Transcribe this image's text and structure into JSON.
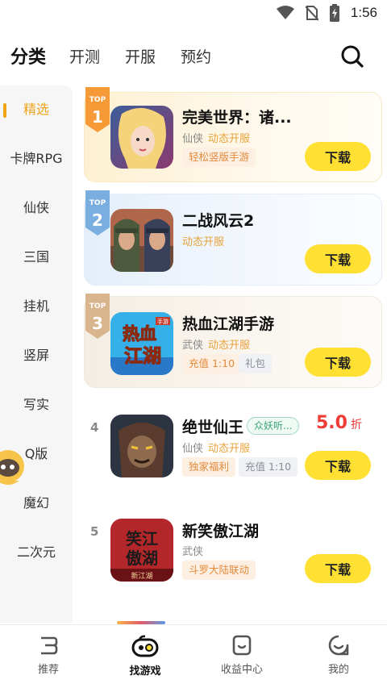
{
  "status_bar": {
    "time": "1:56",
    "icons": [
      "wifi-icon",
      "no-sim-icon",
      "battery-charging-icon"
    ]
  },
  "header": {
    "tabs": [
      {
        "label": "分类",
        "active": true
      },
      {
        "label": "开测",
        "active": false
      },
      {
        "label": "开服",
        "active": false
      },
      {
        "label": "预约",
        "active": false
      }
    ],
    "search_icon": "search-icon"
  },
  "sidebar": {
    "items": [
      {
        "label": "精选",
        "active": true
      },
      {
        "label": "卡牌RPG"
      },
      {
        "label": "仙侠"
      },
      {
        "label": "三国"
      },
      {
        "label": "挂机"
      },
      {
        "label": "竖屏"
      },
      {
        "label": "写实"
      },
      {
        "label": "Q版"
      },
      {
        "label": "魔幻"
      },
      {
        "label": "二次元"
      }
    ]
  },
  "games": [
    {
      "rank": "1",
      "rank_badge": "TOP",
      "title": "完美世界：诸...",
      "genre": "仙侠",
      "feature": "动态开服",
      "tags": [
        "轻松竖版手游"
      ],
      "button": "下载"
    },
    {
      "rank": "2",
      "rank_badge": "TOP",
      "title": "二战风云2",
      "genre": "",
      "feature": "动态开服",
      "tags": [],
      "button": "下载"
    },
    {
      "rank": "3",
      "rank_badge": "TOP",
      "title": "热血江湖手游",
      "genre": "武侠",
      "feature": "动态开服",
      "tags": [
        "充值 1:10",
        "礼包"
      ],
      "button": "下载"
    },
    {
      "rank": "4",
      "title": "绝世仙王",
      "title_badge": "众妖听...",
      "genre": "仙侠",
      "feature": "动态开服",
      "tags": [
        "独家福利",
        "充值 1:10"
      ],
      "discount_value": "5.0",
      "discount_unit": "折",
      "button": "下载"
    },
    {
      "rank": "5",
      "title": "新笑傲江湖",
      "genre": "武侠",
      "feature": "",
      "tags": [
        "斗罗大陆联动"
      ],
      "button": "下载"
    }
  ],
  "icon_text": {
    "game3_line1": "热血",
    "game3_line2": "江湖",
    "game3_corner": "手游",
    "game5_line1": "笑江",
    "game5_line2": "傲湖",
    "game5_footer": "新江湖"
  },
  "bottom_nav": {
    "items": [
      {
        "label": "推荐",
        "active": false
      },
      {
        "label": "找游戏",
        "active": true
      },
      {
        "label": "收益中心",
        "active": false
      },
      {
        "label": "我的",
        "active": false
      }
    ]
  },
  "colors": {
    "accent": "#f1a51b",
    "download_button": "#ffe033",
    "discount": "#ee3b34",
    "feature_text": "#e7a33c"
  }
}
